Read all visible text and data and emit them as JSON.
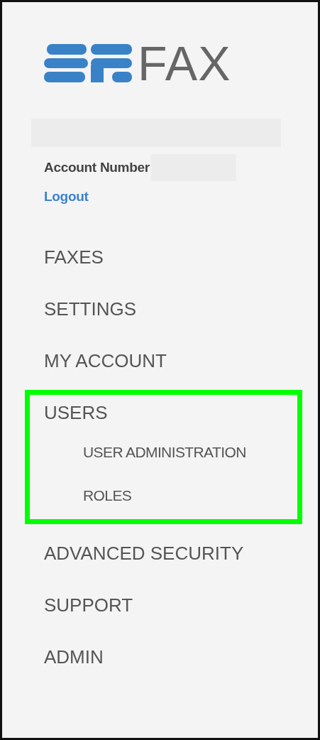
{
  "logo": {
    "text": "FAX"
  },
  "account": {
    "label": "Account Number",
    "logout": "Logout"
  },
  "nav": [
    {
      "label": "FAXES",
      "highlighted": false
    },
    {
      "label": "SETTINGS",
      "highlighted": false
    },
    {
      "label": "MY ACCOUNT",
      "highlighted": false
    },
    {
      "label": "USERS",
      "highlighted": true,
      "children": [
        {
          "label": "USER ADMINISTRATION"
        },
        {
          "label": "ROLES"
        }
      ]
    },
    {
      "label": "ADVANCED SECURITY",
      "highlighted": false
    },
    {
      "label": "SUPPORT",
      "highlighted": false
    },
    {
      "label": "ADMIN",
      "highlighted": false
    }
  ]
}
